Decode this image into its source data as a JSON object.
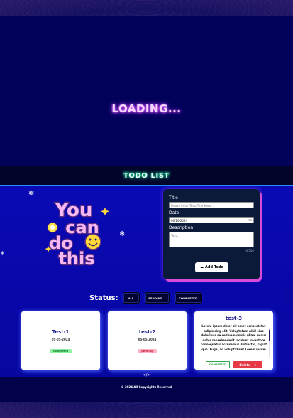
{
  "loader": {
    "text": "LOADING..."
  },
  "header": {
    "title": "TODO LIST"
  },
  "sticker": {
    "lines": [
      "You",
      "can",
      "do",
      "this"
    ],
    "colors": {
      "fill": "#f5b8f2",
      "outline": "#5a2b80",
      "smile": "#ffd83a"
    }
  },
  "form": {
    "title_label": "Title",
    "title_placeholder": "Please Enter Todo Title Here...",
    "date_label": "Date",
    "date_value": "06/10/2024",
    "description_label": "Description",
    "description_placeholder": "Text...",
    "char_count": "0/500",
    "add_button": "Add Todo"
  },
  "status": {
    "label": "Status:",
    "filters": [
      "ALL",
      "PENDING...",
      "COMPLETED"
    ]
  },
  "todos": [
    {
      "title": "Test-1",
      "date": "05-05-2024",
      "status": "completed"
    },
    {
      "title": "test-2",
      "date": "05-05-2024",
      "status": "pending"
    },
    {
      "title": "test-3",
      "description": "Lorem ipsum dolor sit amet consectetur adipisicing elit. Voluptatum nihil eius doloribus se sed nam omnis ullam minus nobis reprehenderit incidunt inventore consequatur accusamus distinctio, fugiat quo. Fuga, ad voluptatum! Lorem ipsum dolor sit amet consectetur adipisicing elit.",
      "actions": {
        "complete": "COMPLETED",
        "delete": "Delete"
      }
    }
  ],
  "footer": {
    "code_icon": "</>",
    "copyright": "© 2024 All Copyrights Reserved"
  },
  "colors": {
    "page_bg": "#0b0a52",
    "main_bg": "#0a0ab4",
    "form_bg": "#0c1a3a",
    "accent_pink": "#d64bd8",
    "accent_blue": "#2b8cff",
    "delete_red": "#e53946",
    "completed_green": "#2fa84f"
  }
}
